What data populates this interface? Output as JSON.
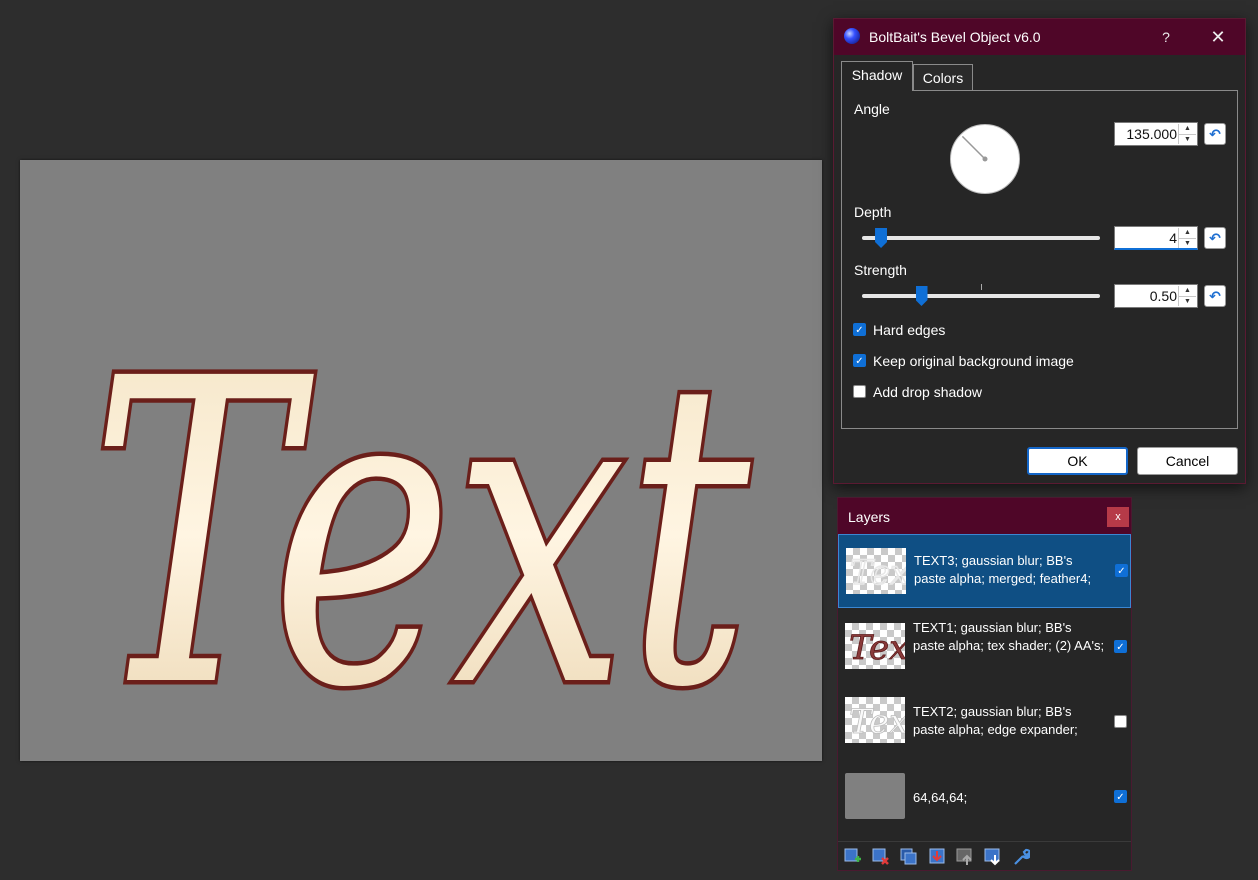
{
  "dialog": {
    "title": "BoltBait's Bevel Object v6.0",
    "help_label": "?",
    "close_label": "✕",
    "tabs": [
      {
        "label": "Shadow",
        "active": true
      },
      {
        "label": "Colors",
        "active": false
      }
    ],
    "angle": {
      "label": "Angle",
      "value": "135.000",
      "degrees": 135
    },
    "depth": {
      "label": "Depth",
      "value": "4",
      "slider_fraction": 0.08
    },
    "strength": {
      "label": "Strength",
      "value": "0.50",
      "slider_fraction": 0.25
    },
    "checkboxes": [
      {
        "label": "Hard edges",
        "checked": true
      },
      {
        "label": "Keep original background image",
        "checked": true
      },
      {
        "label": "Add drop shadow",
        "checked": false
      }
    ],
    "ok_label": "OK",
    "cancel_label": "Cancel"
  },
  "canvas": {
    "text": "Text",
    "background_color": "#808080"
  },
  "layers": {
    "title": "Layers",
    "close_label": "x",
    "items": [
      {
        "name": "TEXT3; gaussian blur; BB's paste alpha; merged; feather4;",
        "visible": true,
        "selected": true,
        "thumb_text": "Text"
      },
      {
        "name": "TEXT1; gaussian blur; BB's paste alpha; tex shader; (2) AA's;",
        "visible": true,
        "selected": false,
        "thumb_text": "Text"
      },
      {
        "name": "TEXT2; gaussian blur; BB's paste alpha; edge expander;",
        "visible": false,
        "selected": false,
        "thumb_text": "Text"
      },
      {
        "name": "64,64,64;",
        "visible": true,
        "selected": false
      }
    ],
    "toolbar_icons": [
      "add-layer-icon",
      "delete-layer-icon",
      "duplicate-layer-icon",
      "merge-down-icon",
      "move-up-icon",
      "move-down-icon",
      "layer-properties-icon"
    ]
  },
  "colors": {
    "title_bar": "#4f0628",
    "accent": "#0f6fd6",
    "selected_layer": "#0f4f84"
  }
}
